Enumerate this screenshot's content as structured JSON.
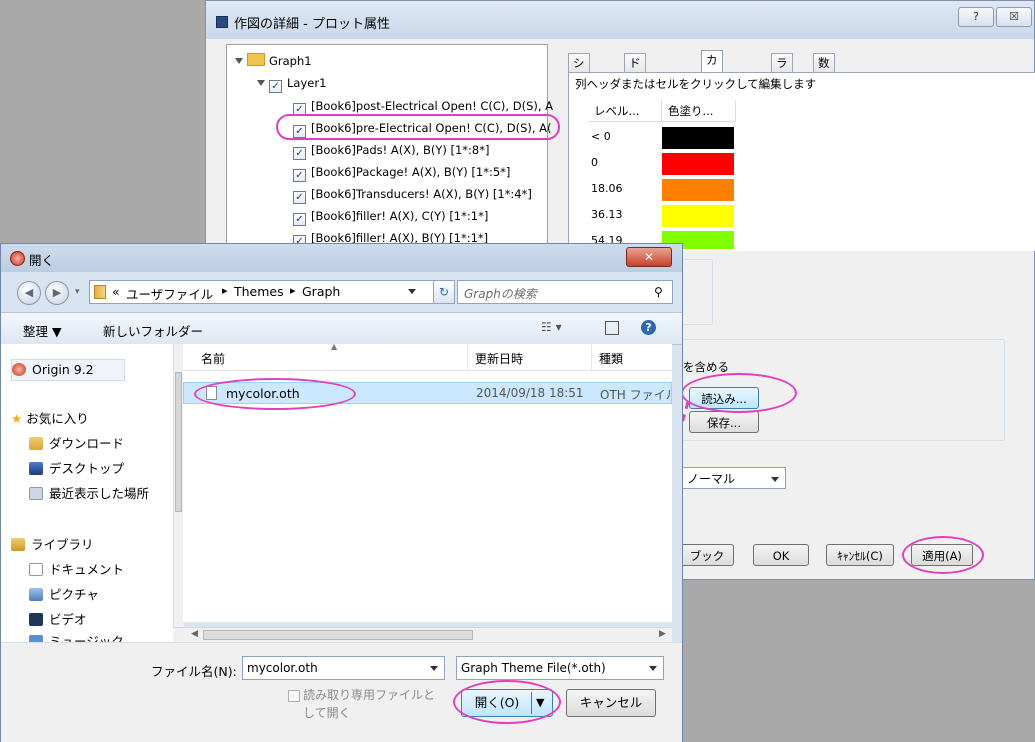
{
  "back_dialog": {
    "title": "作図の詳細 - プロット属性",
    "help_button": "?",
    "close_button": "☒",
    "tree": {
      "graph": "Graph1",
      "layer": "Layer1",
      "items": [
        "[Book6]post-Electrical Open! C(C), D(S), A",
        "[Book6]pre-Electrical Open! C(C), D(S), A(",
        "[Book6]Pads! A(X), B(Y) [1*:8*]",
        "[Book6]Package! A(X), B(Y) [1*:5*]",
        "[Book6]Transducers! A(X), B(Y) [1*:4*]",
        "[Book6]filler! A(X), C(Y) [1*:1*]",
        "[Book6]filler! A(X), B(Y) [1*:1*]"
      ]
    },
    "tabs": [
      "シンボル",
      "ドロップライン",
      "カラーマップ",
      "ラベル",
      "数値の表示形式"
    ],
    "active_tab": "カラーマップ",
    "instruction": "列ヘッダまたはセルをクリックして編集します",
    "colormap": {
      "level_header": "レベル...",
      "fill_header": "色塗り...",
      "levels": [
        "< 0",
        "0",
        "18.06",
        "36.13",
        "54.19"
      ],
      "colors": [
        "#000000",
        "#ff0000",
        "#ff8000",
        "#ffff00",
        "#80ff00"
      ]
    },
    "include_text": "を含める",
    "load_button": "読込み...",
    "save_button": "保存...",
    "mode_value": "ノーマル",
    "workbook_button": "ブック",
    "ok_button": "OK",
    "cancel_button": "ｷｬﾝｾﾙ(C)",
    "apply_button": "適用(A)"
  },
  "open_dialog": {
    "title": "開く",
    "breadcrumb": [
      "«",
      "ユーザファイル",
      "Themes",
      "Graph"
    ],
    "search_placeholder": "Graphの検索",
    "organize": "整理 ▼",
    "new_folder": "新しいフォルダー",
    "nav": {
      "origin": "Origin 9.2",
      "favorites": "お気に入り",
      "downloads": "ダウンロード",
      "desktop": "デスクトップ",
      "recent": "最近表示した場所",
      "libraries": "ライブラリ",
      "documents": "ドキュメント",
      "pictures": "ピクチャ",
      "videos": "ビデオ",
      "music": "ミュージック"
    },
    "columns": {
      "name": "名前",
      "date": "更新日時",
      "type": "種類"
    },
    "files": [
      {
        "name": "mycolor.oth",
        "date": "2014/09/18 18:51",
        "type": "OTH ファイル"
      }
    ],
    "filename_label": "ファイル名(N):",
    "filename_value": "mycolor.oth",
    "filetype_value": "Graph Theme File(*.oth)",
    "readonly_label_1": "読み取り専用ファイルと",
    "readonly_label_2": "して開く",
    "open_button": "開く(O)",
    "cancel_button": "キャンセル"
  },
  "colors": {
    "highlight_ring": "#e040c0",
    "selection": "#cce8ff"
  }
}
